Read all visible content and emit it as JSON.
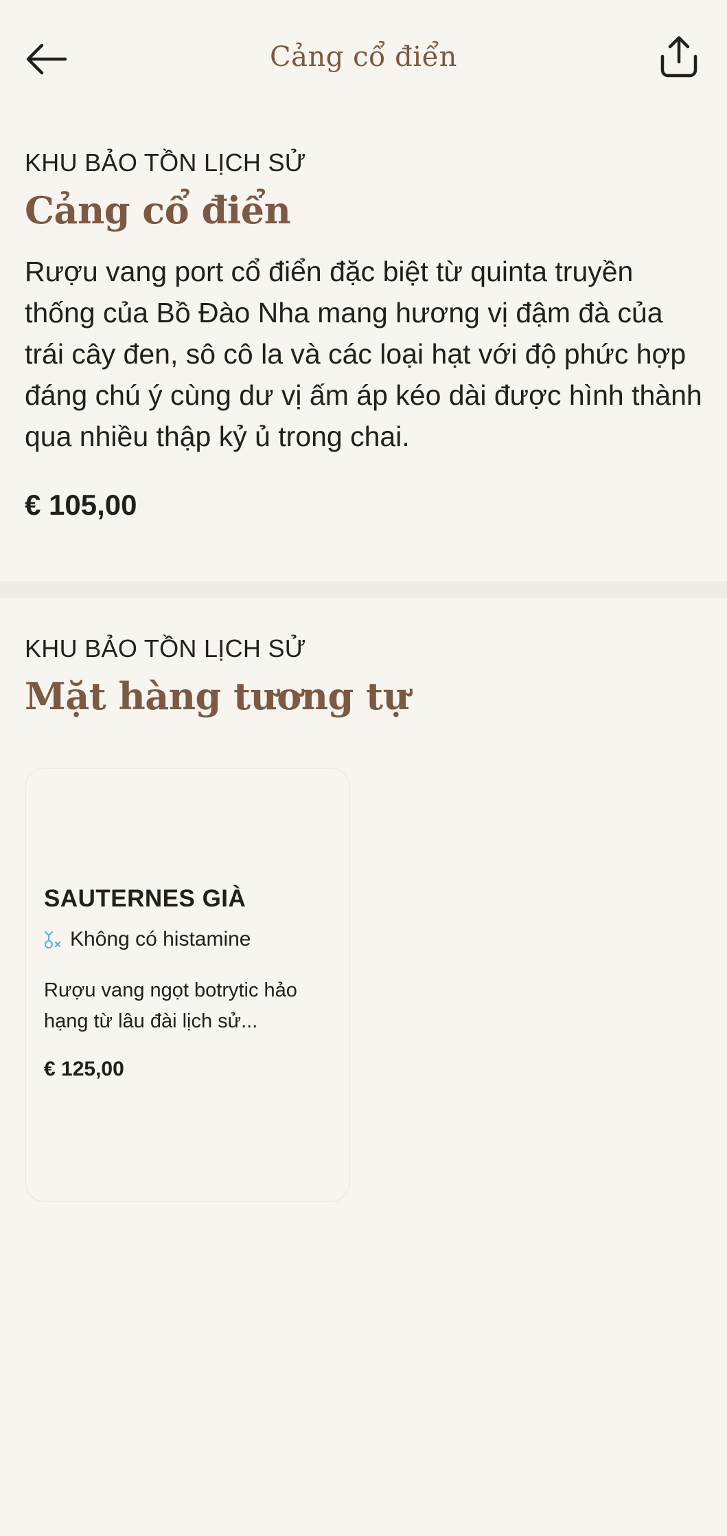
{
  "header": {
    "title": "Cảng cổ điển",
    "back_icon": "arrow-left-icon",
    "share_icon": "share-icon"
  },
  "product": {
    "category": "KHU BẢO TỒN LỊCH SỬ",
    "name": "Cảng cổ điển",
    "description": "Rượu vang port cổ điển đặc biệt từ quinta truyền thống của Bồ Đào Nha mang hương vị đậm đà của trái cây đen, sô cô la và các loại hạt với độ phức hợp đáng chú ý cùng dư vị ấm áp kéo dài được hình thành qua nhiều thập kỷ ủ trong chai.",
    "price": "€ 105,00"
  },
  "similar": {
    "category": "KHU BẢO TỒN LỊCH SỬ",
    "title": "Mặt hàng tương tự",
    "items": [
      {
        "name": "SAUTERNES GIÀ",
        "tag": "Không có histamine",
        "tag_icon": "histamine-free-icon",
        "description": "Rượu vang ngọt botrytic hảo hạng từ lâu đài lịch sử...",
        "price": "€ 125,00"
      }
    ]
  },
  "colors": {
    "background": "#f8f4ef",
    "accent": "#7a5a44",
    "text": "#23201b",
    "divider": "#efebe5",
    "tag_icon": "#4fb3d9"
  }
}
